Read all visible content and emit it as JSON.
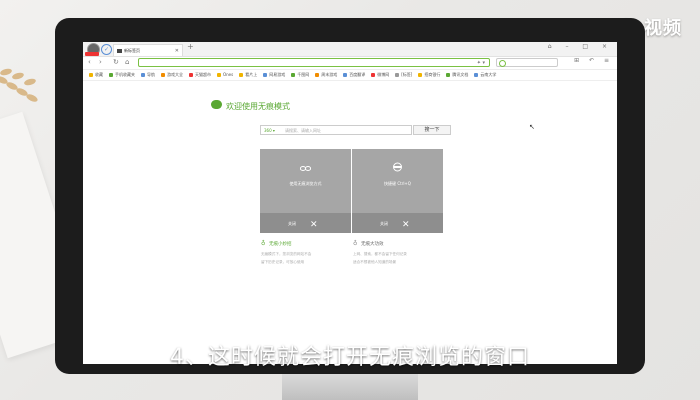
{
  "watermark": "天奇·视频",
  "browser": {
    "tab_title": "新标签页",
    "newtab_symbol": "+",
    "window_controls": "⌂ – □ ×",
    "address_value": "",
    "bookmarks": [
      {
        "label": "收藏",
        "color": "#f0b400"
      },
      {
        "label": "手机收藏夹",
        "color": "#5aa833"
      },
      {
        "label": "导航",
        "color": "#5a8fd6"
      },
      {
        "label": "游戏大全",
        "color": "#f08c00"
      },
      {
        "label": "天猫超市",
        "color": "#e33"
      },
      {
        "label": "Ones",
        "color": "#f0b400"
      },
      {
        "label": "看片上",
        "color": "#f0b400"
      },
      {
        "label": "网易游戏",
        "color": "#5a8fd6"
      },
      {
        "label": "千图网",
        "color": "#5aa833"
      },
      {
        "label": "周末游戏",
        "color": "#f08c00"
      },
      {
        "label": "百度翻译",
        "color": "#5a8fd6"
      },
      {
        "label": "微博网",
        "color": "#e33"
      },
      {
        "label": "[标签]",
        "color": "#999"
      },
      {
        "label": "招商银行",
        "color": "#f0b400"
      },
      {
        "label": "腾讯文档",
        "color": "#5aa833"
      },
      {
        "label": "云南大学",
        "color": "#5a8fd6"
      }
    ]
  },
  "page": {
    "welcome": "欢迎使用无痕模式",
    "search_engine": "360 ▾",
    "search_placeholder": "请搜索、请输入网址",
    "search_button": "搜一下",
    "cards": [
      {
        "title": "使用无痕浏览方式",
        "button": "关闭"
      },
      {
        "title": "快捷键 Ctrl+Q",
        "button": "关闭"
      }
    ],
    "features": [
      {
        "title": "无痕小妙招",
        "lines": [
          "无痕模式下，您浏览的网站不会",
          "留下历史记录，可放心使用"
        ]
      },
      {
        "title": "无痕大功效",
        "lines": [
          "上网、搜索，都不会留下任何记录",
          "适合不想被他人知道的场景"
        ]
      }
    ]
  },
  "subtitle": "4、这时候就会打开无痕浏览的窗口"
}
